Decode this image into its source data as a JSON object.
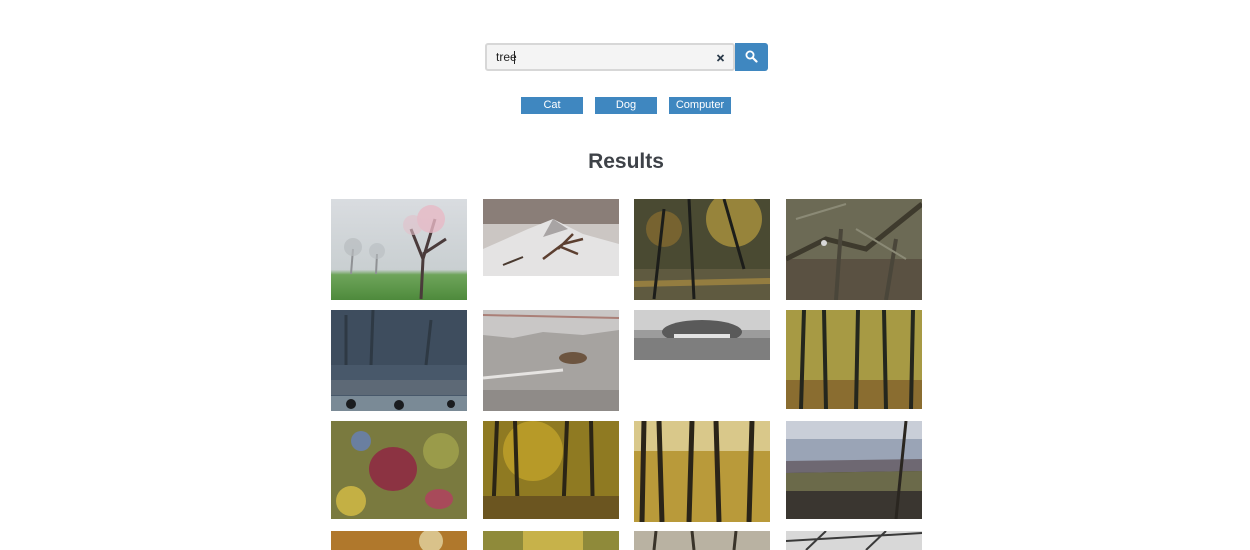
{
  "search": {
    "value": "tree",
    "clear_glyph": "×",
    "clear_icon": "close-icon",
    "submit_icon": "search-icon"
  },
  "tags": [
    {
      "label": "Cat"
    },
    {
      "label": "Dog"
    },
    {
      "label": "Computer"
    }
  ],
  "results": {
    "title": "Results"
  },
  "colors": {
    "accent": "#3f87c0",
    "heading": "#3e4248",
    "input_background": "#f4f4f4",
    "input_border": "#d7d7d7"
  }
}
